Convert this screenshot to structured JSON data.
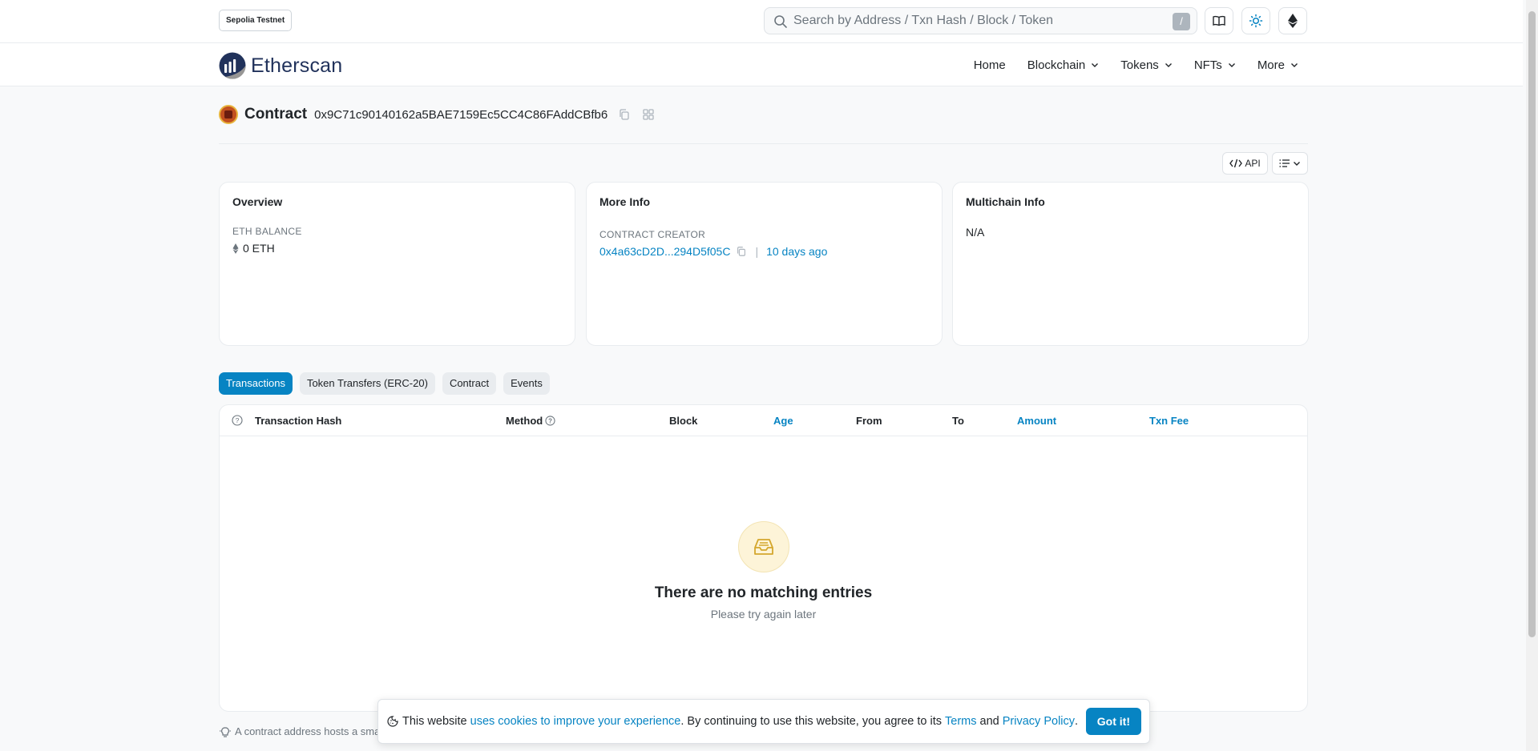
{
  "header": {
    "network_badge": "Sepolia Testnet",
    "search_placeholder": "Search by Address / Txn Hash / Block / Token",
    "search_shortcut": "/"
  },
  "nav": {
    "logo_text": "Etherscan",
    "items": [
      {
        "label": "Home",
        "has_dropdown": false
      },
      {
        "label": "Blockchain",
        "has_dropdown": true
      },
      {
        "label": "Tokens",
        "has_dropdown": true
      },
      {
        "label": "NFTs",
        "has_dropdown": true
      },
      {
        "label": "More",
        "has_dropdown": true
      }
    ]
  },
  "contract": {
    "title": "Contract",
    "address": "0x9C71c90140162a5BAE7159Ec5CC4C86FAddCBfb6"
  },
  "toolbar": {
    "api_label": "API"
  },
  "overview": {
    "title": "Overview",
    "balance_label": "ETH BALANCE",
    "balance_value": "0 ETH"
  },
  "more_info": {
    "title": "More Info",
    "creator_label": "CONTRACT CREATOR",
    "creator_address": "0x4a63cD2D...294D5f05C",
    "separator": "|",
    "created_ago": "10 days ago"
  },
  "multichain": {
    "title": "Multichain Info",
    "value": "N/A"
  },
  "tabs": [
    {
      "label": "Transactions",
      "active": true
    },
    {
      "label": "Token Transfers (ERC-20)",
      "active": false
    },
    {
      "label": "Contract",
      "active": false
    },
    {
      "label": "Events",
      "active": false
    }
  ],
  "table": {
    "columns": {
      "hash": "Transaction Hash",
      "method": "Method",
      "block": "Block",
      "age": "Age",
      "from": "From",
      "to": "To",
      "amount": "Amount",
      "fee": "Txn Fee"
    },
    "empty_title": "There are no matching entries",
    "empty_subtitle": "Please try again later"
  },
  "footer_note": "A contract address hosts a smar",
  "cookie": {
    "text_before": "This website ",
    "link_cookies": "uses cookies to improve your experience",
    "text_middle": ". By continuing to use this website, you agree to its ",
    "link_terms": "Terms",
    "text_and": " and ",
    "link_privacy": "Privacy Policy",
    "text_end": ".",
    "button_label": "Got it!"
  },
  "colors": {
    "accent": "#0784c3",
    "brand_dark": "#21325b",
    "page_bg": "#f8f9fa"
  }
}
